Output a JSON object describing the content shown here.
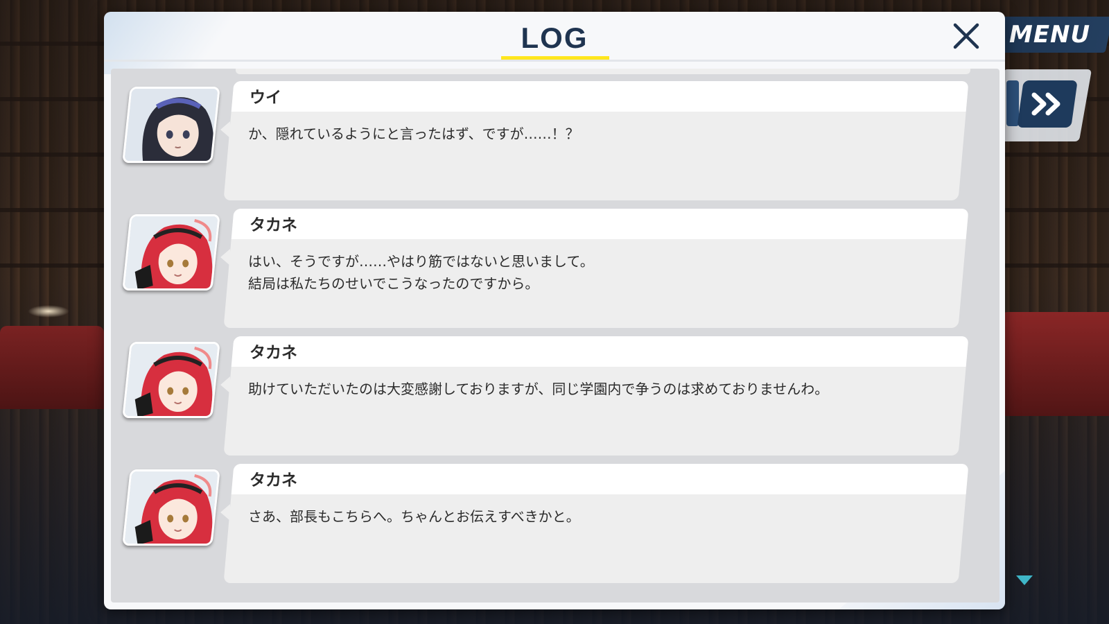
{
  "window": {
    "title": "LOG"
  },
  "controls": {
    "menu_label": "MENU",
    "close_icon": "close-icon",
    "skip_icon": "fast-forward-icon",
    "scroll_icon": "scroll-down-icon"
  },
  "colors": {
    "title_text": "#1f3450",
    "title_underline": "#ffe61e",
    "menu_bg": "#1d3552",
    "bubble_header": "#ffffff",
    "bubble_body": "#eeeeee"
  },
  "log": {
    "entries": [
      {
        "speaker": "ウイ",
        "avatar": "ui-portrait",
        "line1": "か、隠れているようにと言ったはず、ですが……！？",
        "line2": ""
      },
      {
        "speaker": "タカネ",
        "avatar": "takane-portrait",
        "line1": "はい、そうですが……やはり筋ではないと思いまして。",
        "line2": "結局は私たちのせいでこうなったのですから。"
      },
      {
        "speaker": "タカネ",
        "avatar": "takane-portrait",
        "line1": "助けていただいたのは大変感謝しておりますが、同じ学園内で争うのは求めておりませんわ。",
        "line2": ""
      },
      {
        "speaker": "タカネ",
        "avatar": "takane-portrait",
        "line1": "さあ、部長もこちらへ。ちゃんとお伝えすべきかと。",
        "line2": ""
      }
    ]
  }
}
